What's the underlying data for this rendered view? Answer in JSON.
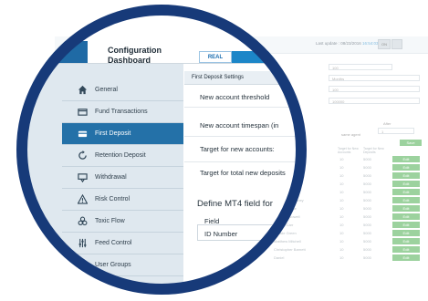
{
  "header": {
    "title": "Configuration\nDashboard",
    "mode_tab": "REAL",
    "last_update": "Last update : 08/23/2016 ",
    "last_update_time": "16:54:03",
    "btn_a": "ON",
    "btn_b": ""
  },
  "sidebar": {
    "items": [
      {
        "label": "General",
        "icon": "home-icon"
      },
      {
        "label": "Fund Transactions",
        "icon": "fund-transactions-icon"
      },
      {
        "label": "First Deposit",
        "icon": "first-deposit-icon",
        "active": true
      },
      {
        "label": "Retention Deposit",
        "icon": "retention-icon"
      },
      {
        "label": "Withdrawal",
        "icon": "withdrawal-icon"
      },
      {
        "label": "Risk Control",
        "icon": "warning-icon"
      },
      {
        "label": "Toxic Flow",
        "icon": "biohazard-icon"
      },
      {
        "label": "Feed Control",
        "icon": "sliders-icon"
      },
      {
        "label": "User Groups",
        "icon": "users-icon"
      }
    ]
  },
  "first_deposit": {
    "section_title": "First Deposit Settings",
    "rows": [
      "New account threshold",
      "New account timespan (in",
      "Target for new accounts:",
      "Target for total new deposits"
    ],
    "define_title": "Define MT4 field for",
    "field_header": "Field",
    "field_value": "ID Number"
  },
  "background": {
    "inputs": [
      "100",
      "Months",
      "100",
      "100000"
    ],
    "same_agent": "same agent",
    "after_label": "After",
    "after_value": "1",
    "save": "Save",
    "col1": "Target for New Accounts",
    "col2": "Target for New Deposits",
    "rows": [
      {
        "name": "",
        "a": "10",
        "b": "5000",
        "btn": "Edit"
      },
      {
        "name": "Leon Isa",
        "a": "10",
        "b": "5000",
        "btn": "Edit"
      },
      {
        "name": "Aaron Newman",
        "a": "10",
        "b": "5000",
        "btn": "Edit"
      },
      {
        "name": "Chris Nalle",
        "a": "10",
        "b": "5000",
        "btn": "Edit"
      },
      {
        "name": "Ann Stephens",
        "a": "10",
        "b": "5000",
        "btn": "Edit"
      },
      {
        "name": "Matthew Mahoney",
        "a": "10",
        "b": "5000",
        "btn": "Edit"
      },
      {
        "name": "Morgan White",
        "a": "10",
        "b": "5000",
        "btn": "Edit"
      },
      {
        "name": "Kevin McDowell",
        "a": "10",
        "b": "5000",
        "btn": "Edit"
      },
      {
        "name": "Sophie Carr",
        "a": "10",
        "b": "5000",
        "btn": "Edit"
      },
      {
        "name": "Natalie Green",
        "a": "10",
        "b": "5000",
        "btn": "Edit"
      },
      {
        "name": "Matthew Mitchell",
        "a": "10",
        "b": "5000",
        "btn": "Edit"
      },
      {
        "name": "Christopher Barnett",
        "a": "10",
        "b": "5000",
        "btn": "Edit"
      },
      {
        "name": "Daniel",
        "a": "10",
        "b": "5000",
        "btn": "Edit"
      }
    ]
  },
  "colors": {
    "ring": "#173a79",
    "accent": "#1c86c8",
    "active_item": "#2471a8",
    "sidebar_bg": "#dfe8ef",
    "success": "#4caf50"
  }
}
